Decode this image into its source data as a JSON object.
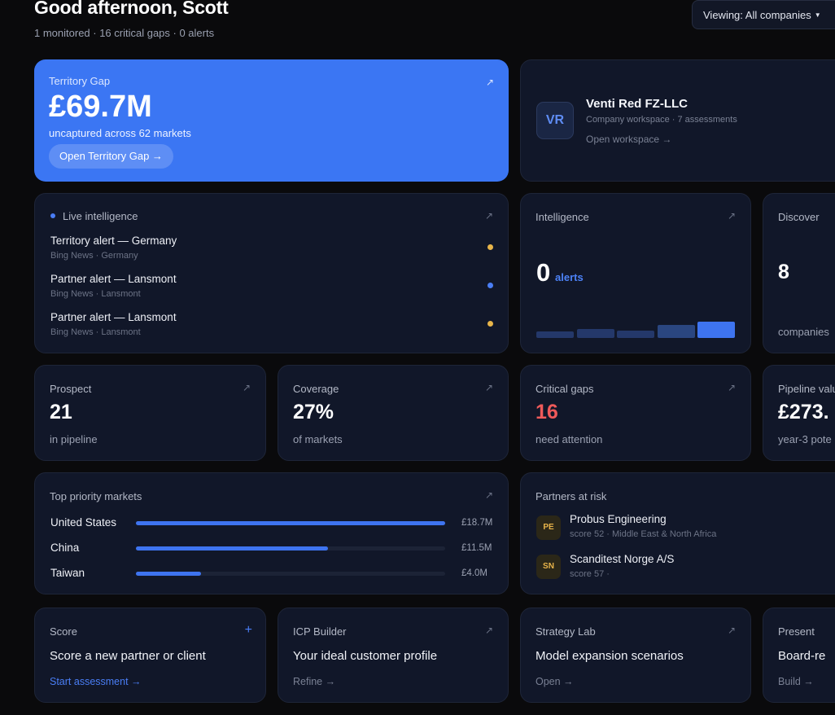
{
  "header": {
    "greeting": "Good afternoon, Scott",
    "subline": "1 monitored · 16 critical gaps · 0 alerts",
    "viewing": "Viewing: All companies"
  },
  "territory_gap": {
    "label": "Territory Gap",
    "value": "£69.7M",
    "description": "uncaptured across 62 markets",
    "button": "Open Territory Gap →"
  },
  "workspace": {
    "initials": "VR",
    "name": "Venti Red FZ-LLC",
    "meta": "Company workspace · 7 assessments",
    "link": "Open workspace →"
  },
  "live_intelligence": {
    "label": "Live intelligence",
    "items": [
      {
        "title": "Territory alert — Germany",
        "source": "Bing News · Germany",
        "status_color": "#e8b54a"
      },
      {
        "title": "Partner alert — Lansmont",
        "source": "Bing News · Lansmont",
        "status_color": "#4a7ef5"
      },
      {
        "title": "Partner alert — Lansmont",
        "source": "Bing News · Lansmont",
        "status_color": "#e8b54a"
      }
    ]
  },
  "intelligence": {
    "label": "Intelligence",
    "value": "0",
    "unit": "alerts",
    "activity_levels": [
      0.35,
      0.45,
      0.38,
      0.65,
      0.85
    ]
  },
  "discover": {
    "label": "Discover",
    "value": "8",
    "sub": "companies"
  },
  "stats": [
    {
      "label": "Prospect",
      "value": "21",
      "sub": "in pipeline"
    },
    {
      "label": "Coverage",
      "value": "27%",
      "sub": "of markets"
    },
    {
      "label": "Critical gaps",
      "value": "16",
      "sub": "need attention"
    },
    {
      "label": "Pipeline value",
      "value": "£273.",
      "sub": "year-3 pote"
    }
  ],
  "top_markets": {
    "label": "Top priority markets",
    "items": [
      {
        "name": "United States",
        "value": "£18.7M",
        "share": 1.0
      },
      {
        "name": "China",
        "value": "£11.5M",
        "share": 0.62
      },
      {
        "name": "Taiwan",
        "value": "£4.0M",
        "share": 0.21
      }
    ]
  },
  "partners_at_risk": {
    "label": "Partners at risk",
    "items": [
      {
        "initials": "PE",
        "name": "Probus Engineering",
        "meta": "score 52 · Middle East & North Africa"
      },
      {
        "initials": "SN",
        "name": "Scanditest Norge A/S",
        "meta": "score 57 ·"
      }
    ]
  },
  "actions": [
    {
      "label": "Score",
      "title": "Score a new partner or client",
      "link": "Start assessment →"
    },
    {
      "label": "ICP Builder",
      "title": "Your ideal customer profile",
      "link": "Refine →"
    },
    {
      "label": "Strategy Lab",
      "title": "Model expansion scenarios",
      "link": "Open →"
    },
    {
      "label": "Present",
      "title": "Board-re",
      "link": "Build →"
    }
  ],
  "colors": {
    "accent": "#3b76f3",
    "critical": "#ef5a5a",
    "warning": "#e8b54a"
  }
}
